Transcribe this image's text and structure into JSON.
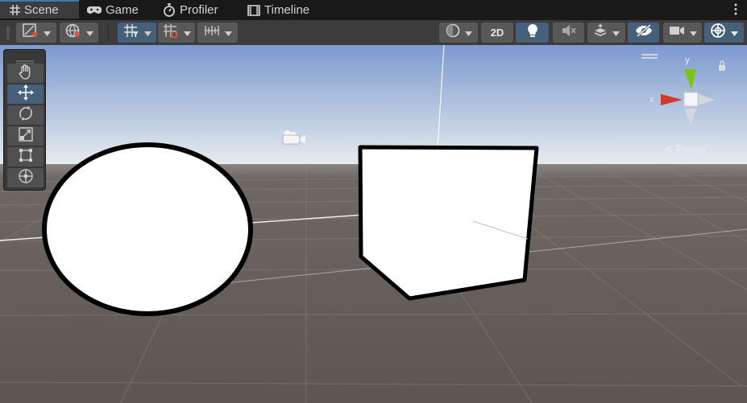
{
  "tabs": [
    {
      "label": "Scene",
      "icon": "hash-grid-icon",
      "active": true
    },
    {
      "label": "Game",
      "icon": "gamepad-icon",
      "active": false
    },
    {
      "label": "Profiler",
      "icon": "stopwatch-icon",
      "active": false
    },
    {
      "label": "Timeline",
      "icon": "film-strip-icon",
      "active": false
    }
  ],
  "toolbar": {
    "view_2d_label": "2D"
  },
  "gizmo": {
    "projection_label": "Persp",
    "axis_y": "y",
    "axis_x": "x"
  },
  "colors": {
    "accent": "#46607c",
    "tab_highlight": "#3a79bb",
    "axis_x": "#d1392b",
    "axis_y": "#79c417",
    "toolbar": "#3c3c3c",
    "ground": "#615a55"
  }
}
